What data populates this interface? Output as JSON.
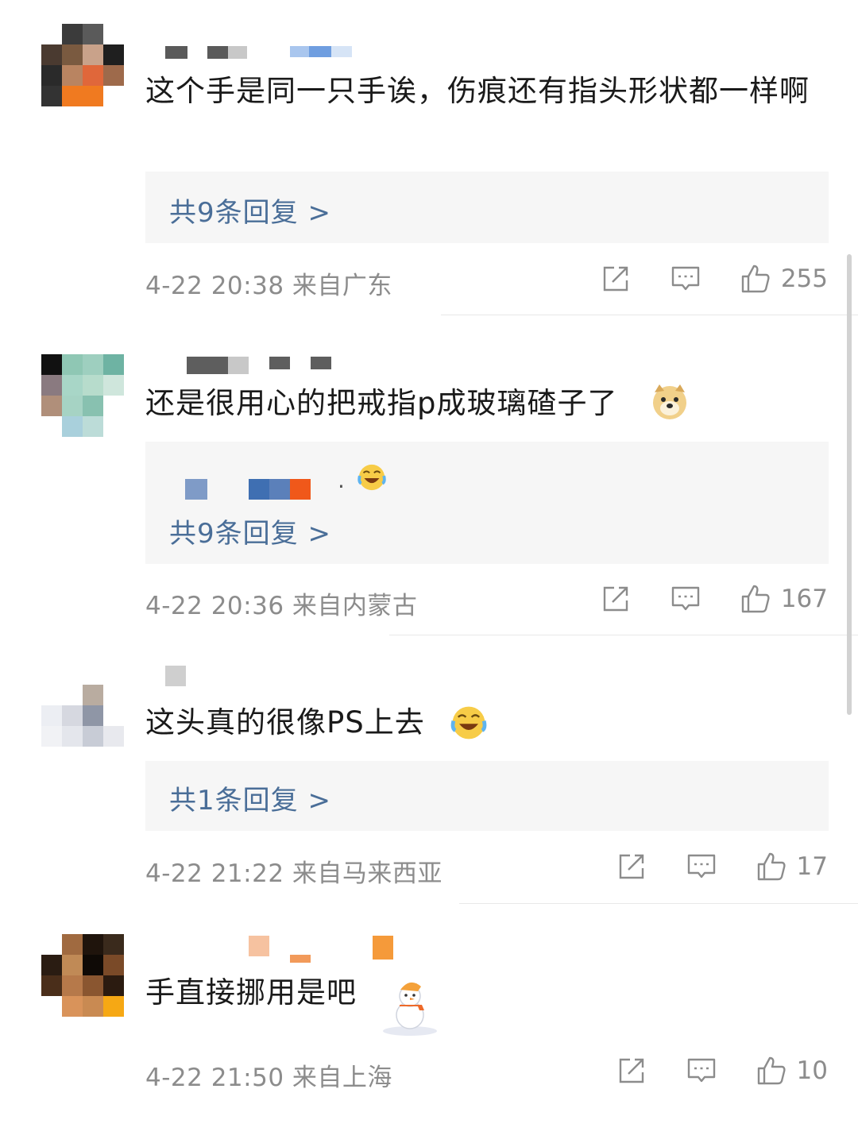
{
  "comments": [
    {
      "text": "这个手是同一只手诶，伤痕还有指头形状都一样啊",
      "reply_link": "共9条回复 >",
      "meta": "4-22 20:38 来自广东",
      "likes": "255"
    },
    {
      "text": "还是很用心的把戒指p成玻璃碴子了",
      "reply_preview_suffix": "·",
      "reply_link": "共9条回复 >",
      "meta": "4-22 20:36 来自内蒙古",
      "likes": "167"
    },
    {
      "text": "这头真的很像PS上去",
      "reply_link": "共1条回复 >",
      "meta": "4-22 21:22 来自马来西亚",
      "likes": "17"
    },
    {
      "text": "手直接挪用是吧",
      "meta": "4-22 21:50 来自上海",
      "likes": "10"
    }
  ],
  "icons": {
    "share": "share-icon",
    "comment": "comment-icon",
    "like": "thumbs-up-icon",
    "emoji_doge": "doge-emoji-icon",
    "emoji_laugh": "laugh-cry-emoji-icon",
    "emoji_snowman": "snowman-sticker-icon"
  },
  "colors": {
    "link": "#4a6e98",
    "meta": "#8c8c8c",
    "reply_bg": "#f6f6f6"
  }
}
